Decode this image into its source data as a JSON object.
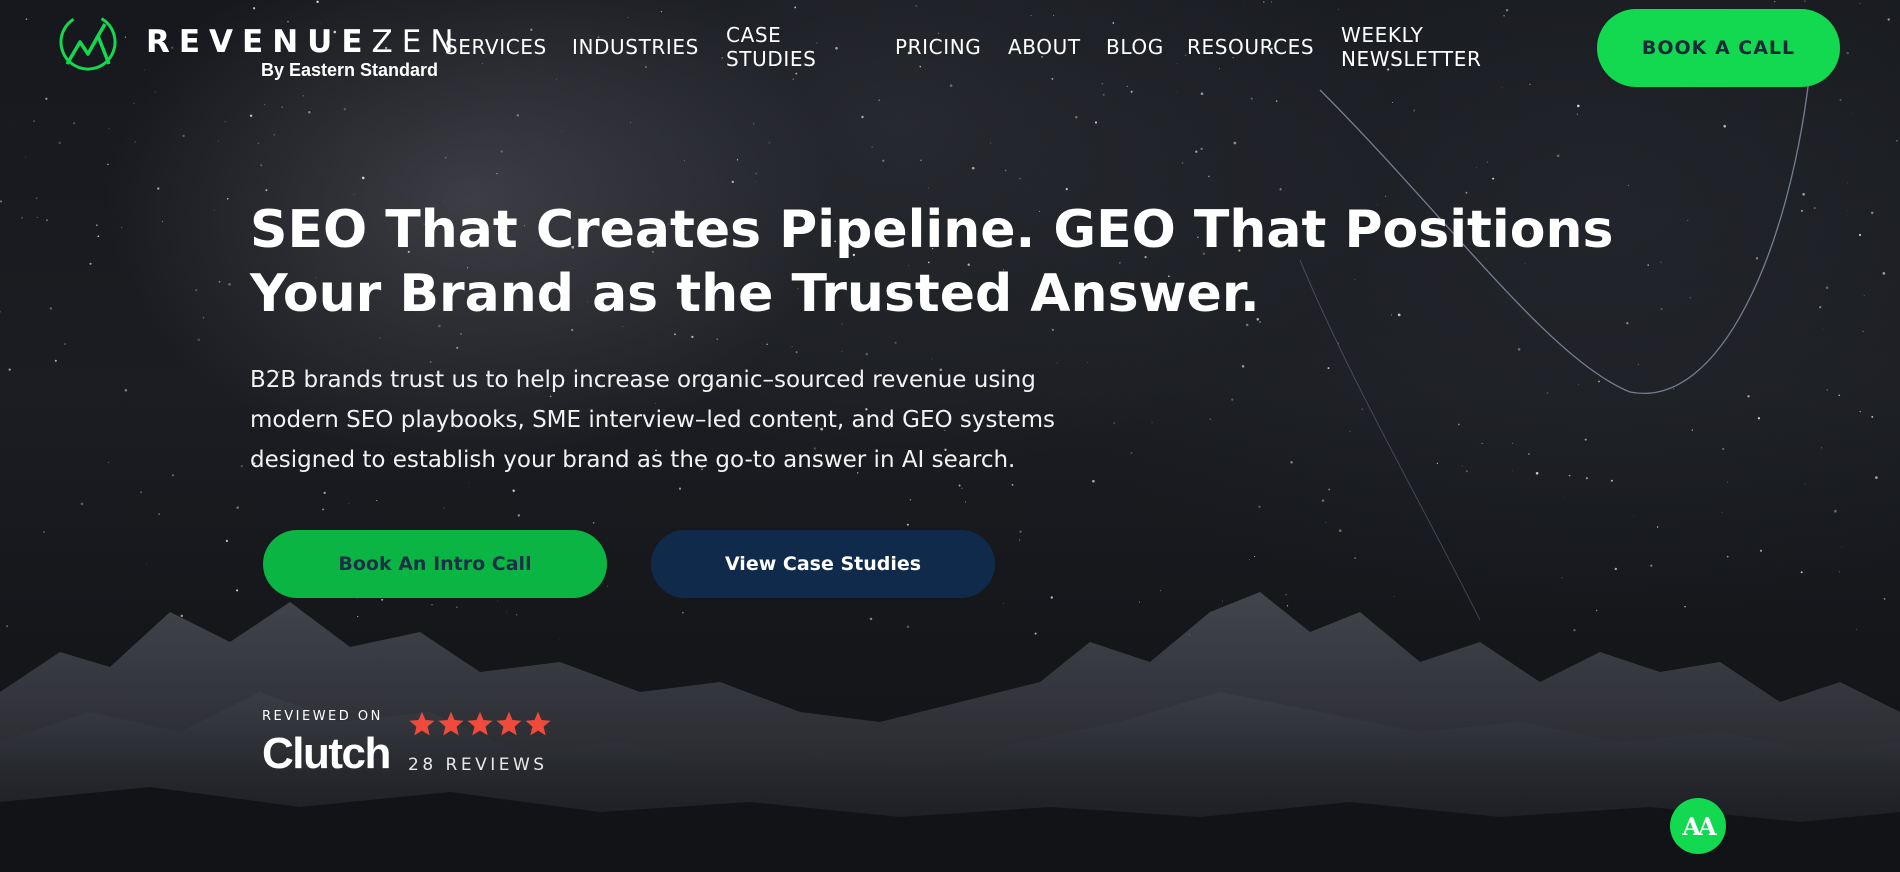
{
  "brand": {
    "word_bold": "REVENUE",
    "word_light": "ZEN",
    "tagline": "By Eastern Standard",
    "accent": "#12d950"
  },
  "nav": {
    "items": [
      {
        "label": "SERVICES"
      },
      {
        "label": "INDUSTRIES"
      },
      {
        "label_line1": "CASE",
        "label_line2": "STUDIES"
      },
      {
        "label": "PRICING"
      },
      {
        "label": "ABOUT"
      },
      {
        "label": "BLOG"
      },
      {
        "label": "RESOURCES"
      },
      {
        "label_line1": "WEEKLY",
        "label_line2": "NEWSLETTER"
      }
    ],
    "cta_label": "BOOK A CALL"
  },
  "hero": {
    "title_line1": "SEO That Creates Pipeline. GEO That Positions",
    "title_line2": "Your Brand as the Trusted Answer.",
    "sub_line1": "B2B brands trust us to help increase organic–sourced revenue using",
    "sub_line2": "modern SEO playbooks, SME interview–led content, and GEO systems",
    "sub_line3": "designed to establish your brand as the go-to answer in AI search.",
    "primary_button": "Book An Intro Call",
    "secondary_button": "View Case Studies",
    "primary_color": "#0bb543",
    "secondary_color": "#0f2a4b"
  },
  "clutch": {
    "reviewed_on": "REVIEWED ON",
    "logo_text": "Clutch",
    "rating": 5,
    "review_count": "28 REVIEWS",
    "star_color": "#ef4a3c"
  },
  "accessibility": {
    "label": "AA",
    "icon": "accessibility-icon"
  }
}
